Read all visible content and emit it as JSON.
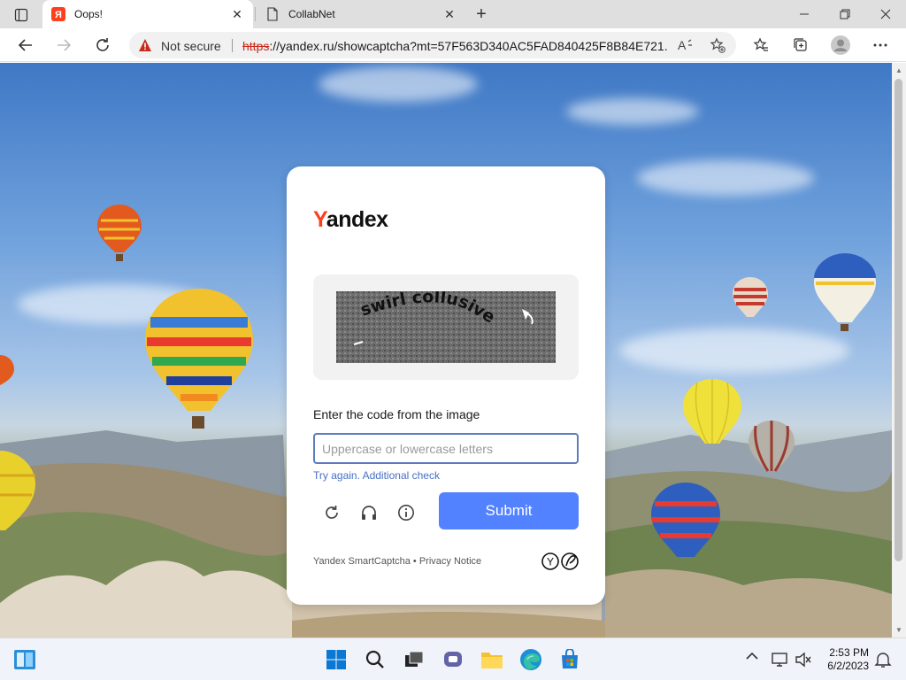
{
  "browser": {
    "tabs": [
      {
        "title": "Oops!",
        "favicon": "yandex-favicon",
        "active": true
      },
      {
        "title": "CollabNet",
        "favicon": "page-icon",
        "active": false
      }
    ],
    "security_label": "Not secure",
    "url_scheme": "https",
    "url_rest": "://yandex.ru/showcaptcha?mt=57F563D340AC5FAD840425F8B84E721..."
  },
  "captcha": {
    "logo_y": "Y",
    "logo_rest": "andex",
    "captcha_text": "swirl collusive",
    "instruction": "Enter the code from the image",
    "input_placeholder": "Uppercase or lowercase letters",
    "input_value": "",
    "error_message": "Try again. Additional check",
    "submit_label": "Submit",
    "footer_brand": "Yandex SmartCaptcha",
    "footer_separator": " • ",
    "footer_link": "Privacy Notice",
    "accent_color": "#5282ff"
  },
  "taskbar": {
    "time": "2:53 PM",
    "date": "6/2/2023"
  }
}
